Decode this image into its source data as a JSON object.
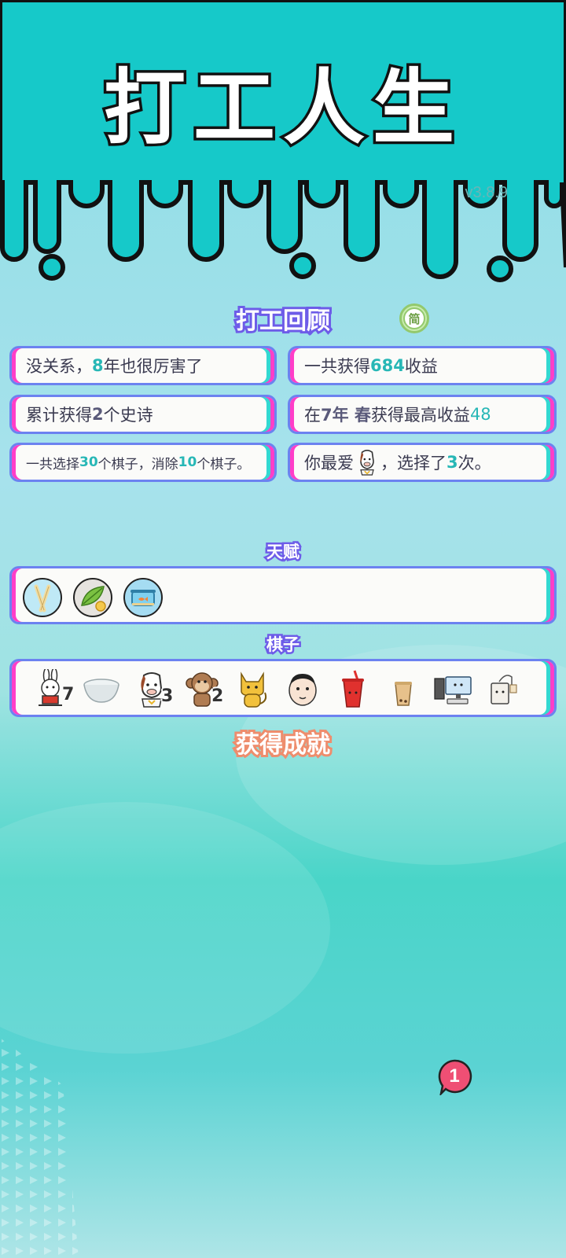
{
  "app": {
    "title": "打工人生",
    "version": "v3.8.9"
  },
  "sections": {
    "review": "打工回顾",
    "talent": "天赋",
    "pieces": "棋子",
    "achievements": "获得成就",
    "simple_toggle": "简"
  },
  "review_cards": {
    "c1": {
      "pre": "没关系，",
      "num": "8",
      "post": "年也很厉害了"
    },
    "c2": {
      "pre": "一共获得",
      "num": "684",
      "post": "收益"
    },
    "c3": {
      "pre": "累计获得",
      "num": "2",
      "post": "个史诗"
    },
    "c4": {
      "pre": "在 ",
      "year": "7年 春",
      "mid": " 获得最高收益",
      "num": "48"
    },
    "c5": {
      "pre": "一共选择",
      "num1": "30",
      "mid": "个棋子，消除",
      "num2": "10",
      "post": "个棋子。"
    },
    "c6": {
      "pre": "你最爱",
      "mid": "，选择了",
      "num": "3",
      "post": "次。",
      "favorite_icon": "horse-piece"
    }
  },
  "talents": [
    "chopsticks-icon",
    "leaf-coin-icon",
    "fishbowl-icon"
  ],
  "pieces": [
    {
      "icon": "rabbit-icon",
      "count": "7"
    },
    {
      "icon": "bowl-icon",
      "count": ""
    },
    {
      "icon": "horse-icon",
      "count": "3"
    },
    {
      "icon": "monkey-icon",
      "count": "2"
    },
    {
      "icon": "cat-icon",
      "count": ""
    },
    {
      "icon": "face-icon",
      "count": ""
    },
    {
      "icon": "soda-cup-icon",
      "count": ""
    },
    {
      "icon": "milk-tea-icon",
      "count": ""
    },
    {
      "icon": "computer-icon",
      "count": ""
    },
    {
      "icon": "teabag-icon",
      "count": ""
    }
  ],
  "notification": {
    "count": "1"
  },
  "colors": {
    "teal": "#16c9c9",
    "accent_purple": "#6d5ce8",
    "highlight": "#27b7b6",
    "achievement": "#ee8d6d",
    "notif_red": "#ef4f74"
  }
}
